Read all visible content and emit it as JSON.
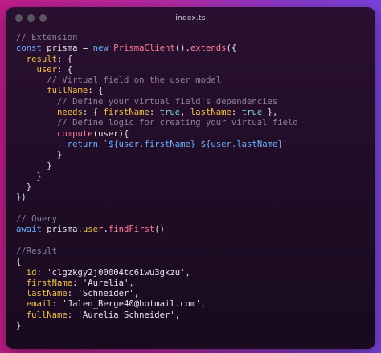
{
  "window": {
    "title": "index.ts"
  },
  "colors": {
    "background_start": "#c41e8d",
    "background_end": "#7a44df",
    "window_bg": "#200c26",
    "comment": "#8a8098",
    "keyword": "#6fb0ff",
    "property": "#f3c24a",
    "boolean": "#7fdcd5",
    "function": "#ff7a9a"
  },
  "code": {
    "l1": {
      "comment": "// Extension"
    },
    "l2": {
      "kw": "const",
      "name": " prisma = ",
      "kw2": "new",
      "cls": " PrismaClient",
      "p1": "().",
      "fn": "extends",
      "p2": "({"
    },
    "l3": {
      "indent": "  ",
      "prop": "result",
      "rest": ": {"
    },
    "l4": {
      "indent": "    ",
      "prop": "user",
      "rest": ": {"
    },
    "l5": {
      "indent": "      ",
      "comment": "// Virtual field on the user model"
    },
    "l6": {
      "indent": "      ",
      "prop": "fullName",
      "rest": ": {"
    },
    "l7": {
      "indent": "        ",
      "comment": "// Define your virtual field's dependencies"
    },
    "l8": {
      "indent": "        ",
      "prop": "needs",
      "p1": ": { ",
      "prop2": "firstName",
      "p2": ": ",
      "b1": "true",
      "p3": ", ",
      "prop3": "lastName",
      "p4": ": ",
      "b2": "true",
      "p5": " },"
    },
    "l9": {
      "indent": "        ",
      "comment": "// Define logic for creating your virtual field"
    },
    "l10": {
      "indent": "        ",
      "fn": "compute",
      "p1": "(",
      "arg": "user",
      "p2": "){"
    },
    "l11": {
      "indent": "          ",
      "kw": "return",
      "s1": " `",
      "t1": "${user.firstName}",
      "s2": " ",
      "t2": "${user.lastName}",
      "s3": "`"
    },
    "l12": {
      "text": "        }"
    },
    "l13": {
      "text": "      }"
    },
    "l14": {
      "text": "    }"
    },
    "l15": {
      "text": "  }"
    },
    "l16": {
      "text": "})"
    },
    "l17": {
      "text": ""
    },
    "l18": {
      "comment": "// Query"
    },
    "l19": {
      "kw": "await",
      "name": " prisma.",
      "prop": "user",
      "p1": ".",
      "fn": "findFirst",
      "p2": "()"
    },
    "l20": {
      "text": ""
    },
    "l21": {
      "comment": "//Result"
    },
    "l22": {
      "text": "{"
    },
    "l23": {
      "indent": "  ",
      "key": "id",
      "val": ": 'clgzkgy2j00004tc6iwu3gkzu',"
    },
    "l24": {
      "indent": "  ",
      "key": "firstName",
      "val": ": 'Aurelia',"
    },
    "l25": {
      "indent": "  ",
      "key": "lastName",
      "val": ": 'Schneider',"
    },
    "l26": {
      "indent": "  ",
      "key": "email",
      "val": ": 'Jalen_Berge40@hotmail.com',"
    },
    "l27": {
      "indent": "  ",
      "key": "fullName",
      "val": ": 'Aurelia Schneider',"
    },
    "l28": {
      "text": "}"
    }
  }
}
